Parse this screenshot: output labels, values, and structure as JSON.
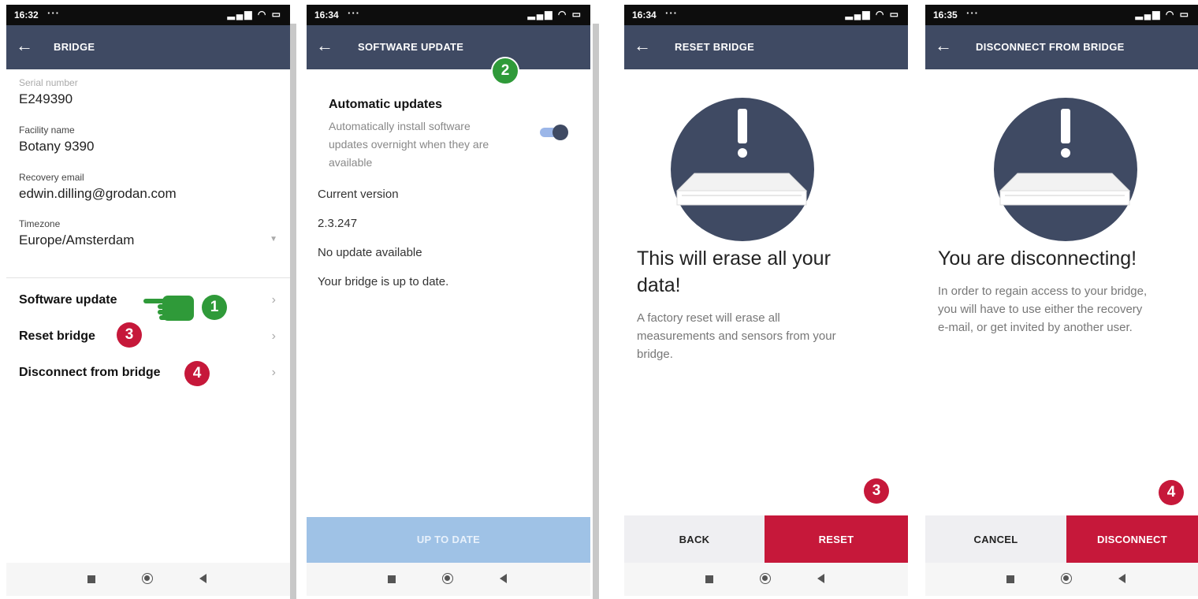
{
  "screens": [
    {
      "status_time": "16:32",
      "title": "BRIDGE",
      "fields": [
        {
          "label": "Serial number",
          "value": "E249390"
        },
        {
          "label": "Facility name",
          "value": "Botany 9390"
        },
        {
          "label": "Recovery email",
          "value": "edwin.dilling@grodan.com"
        },
        {
          "label": "Timezone",
          "value": "Europe/Amsterdam"
        }
      ],
      "menu": [
        {
          "label": "Software update",
          "badge": "1"
        },
        {
          "label": "Reset bridge",
          "badge": "3"
        },
        {
          "label": "Disconnect from bridge",
          "badge": "4"
        }
      ]
    },
    {
      "status_time": "16:34",
      "title": "SOFTWARE UPDATE",
      "badge": "2",
      "auto_title": "Automatic updates",
      "auto_desc_lines": [
        "Automatically install software",
        "updates overnight when they are",
        "available"
      ],
      "auto_enabled": true,
      "lines": [
        "Current version",
        "2.3.247",
        "No update available",
        "Your bridge is up to date."
      ],
      "button": "UP TO DATE"
    },
    {
      "status_time": "16:34",
      "title": "RESET BRIDGE",
      "heading_lines": [
        "This will erase all your",
        "data!"
      ],
      "para_lines": [
        "A factory reset will erase all",
        "measurements and sensors from your",
        "bridge."
      ],
      "badge": "3",
      "left_button": "BACK",
      "right_button": "RESET"
    },
    {
      "status_time": "16:35",
      "title": "DISCONNECT FROM BRIDGE",
      "heading_lines": [
        "You are disconnecting!"
      ],
      "para_lines": [
        "In order to regain access to your bridge,",
        "you will have to use either the recovery",
        "e-mail, or get invited by another user."
      ],
      "badge": "4",
      "left_button": "CANCEL",
      "right_button": "DISCONNECT"
    }
  ],
  "colors": {
    "appbar": "#3f4a63",
    "accent_red": "#c6183a",
    "accent_green": "#2f9a39",
    "disabled_button": "#9fc2e6"
  },
  "icons": {
    "back": "arrow-left-icon",
    "chevron": "chevron-right-icon",
    "pointer": "pointing-hand-icon",
    "warning": "exclamation-icon"
  }
}
